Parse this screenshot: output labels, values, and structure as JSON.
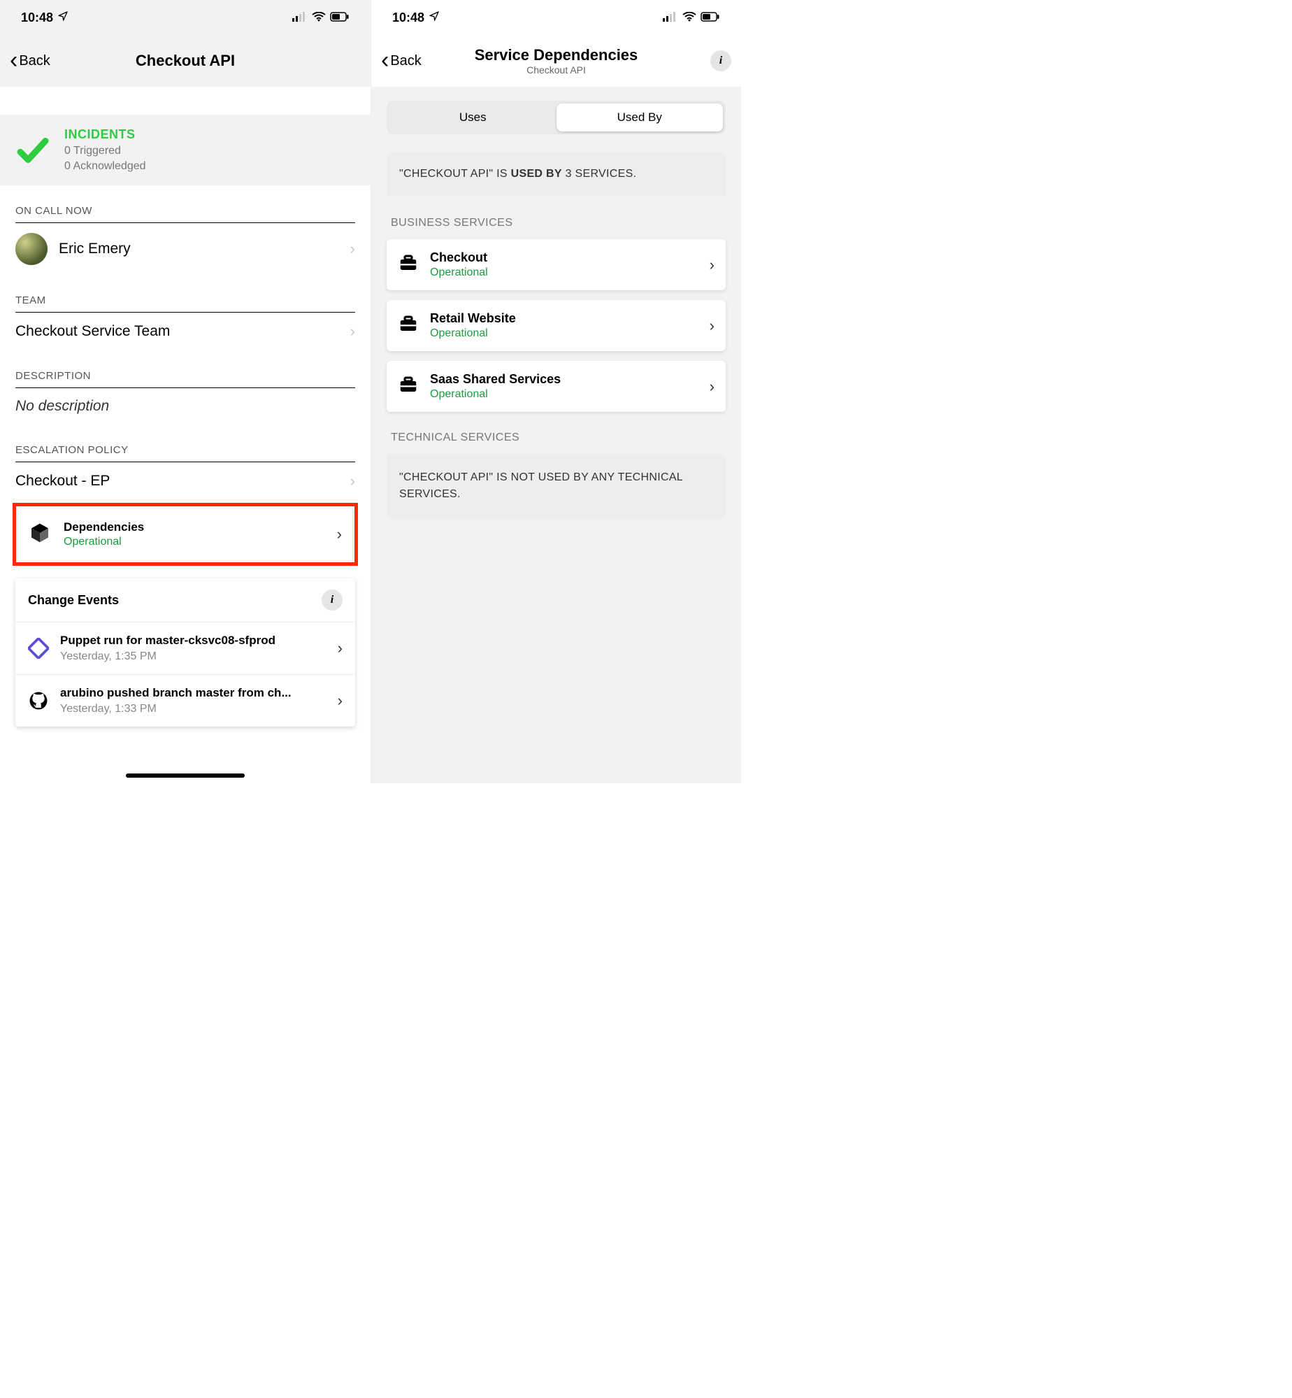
{
  "status": {
    "time": "10:48"
  },
  "left": {
    "nav": {
      "back": "Back",
      "title": "Checkout API"
    },
    "incidents": {
      "heading": "INCIDENTS",
      "triggered": "0 Triggered",
      "acknowledged": "0 Acknowledged"
    },
    "oncall": {
      "label": "ON CALL NOW",
      "name": "Eric Emery"
    },
    "team": {
      "label": "TEAM",
      "value": "Checkout Service Team"
    },
    "description": {
      "label": "DESCRIPTION",
      "value": "No description"
    },
    "escalation": {
      "label": "ESCALATION POLICY",
      "value": "Checkout - EP"
    },
    "dependencies": {
      "title": "Dependencies",
      "status": "Operational"
    },
    "changeEvents": {
      "title": "Change Events",
      "items": [
        {
          "title": "Puppet run for master-cksvc08-sfprod",
          "time": "Yesterday, 1:35 PM"
        },
        {
          "title": "arubino pushed branch master from ch...",
          "time": "Yesterday, 1:33 PM"
        }
      ]
    }
  },
  "right": {
    "nav": {
      "back": "Back",
      "title": "Service Dependencies",
      "subtitle": "Checkout API"
    },
    "segment": {
      "uses": "Uses",
      "usedBy": "Used By",
      "active": "usedBy"
    },
    "summaryPrefix": "\"CHECKOUT API\" IS ",
    "summaryBold": "USED BY",
    "summarySuffix": " 3 SERVICES.",
    "businessLabel": "BUSINESS SERVICES",
    "businessServices": [
      {
        "name": "Checkout",
        "status": "Operational"
      },
      {
        "name": "Retail Website",
        "status": "Operational"
      },
      {
        "name": "Saas Shared Services",
        "status": "Operational"
      }
    ],
    "technicalLabel": "TECHNICAL SERVICES",
    "technicalEmpty": "\"CHECKOUT API\" IS NOT USED BY ANY TECHNICAL SERVICES."
  }
}
